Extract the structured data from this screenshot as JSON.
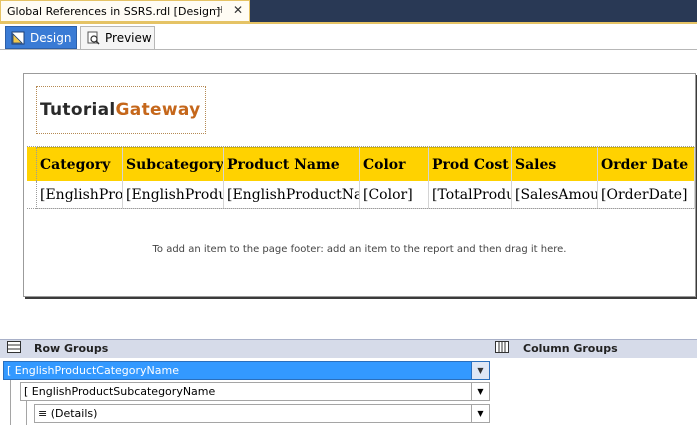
{
  "document_tab": {
    "title": "Global References in SSRS.rdl [Design]",
    "pin_glyph": "⊣",
    "close_glyph": "✕"
  },
  "mode_tabs": {
    "design": "Design",
    "preview": "Preview"
  },
  "logo": {
    "part1": "Tutorial",
    "part2": "Gateway",
    "colors": {
      "part1": "#2a2a2a",
      "part2": "#c5671b"
    }
  },
  "table": {
    "header_color": "#ffd200",
    "headers": [
      "Category",
      "Subcategory",
      "Product Name",
      "Color",
      "Prod Cost",
      "Sales",
      "Order Date"
    ],
    "details": [
      "[EnglishPro",
      "[EnglishProdu",
      "[EnglishProductNa",
      "[Color]",
      "[TotalProdu",
      "[SalesAmou",
      "[OrderDate]"
    ]
  },
  "footer_hint": "To add an item to the page footer: add an item to the report and then drag it here.",
  "groups": {
    "row_groups_label": "Row Groups",
    "column_groups_label": "Column Groups",
    "row_groups": [
      {
        "label": "[ EnglishProductCategoryName",
        "selected": true
      },
      {
        "label": "[ EnglishProductSubcategoryName",
        "selected": false
      },
      {
        "label": "≡ (Details)",
        "selected": false
      }
    ],
    "dropdown_glyph": "▼"
  }
}
